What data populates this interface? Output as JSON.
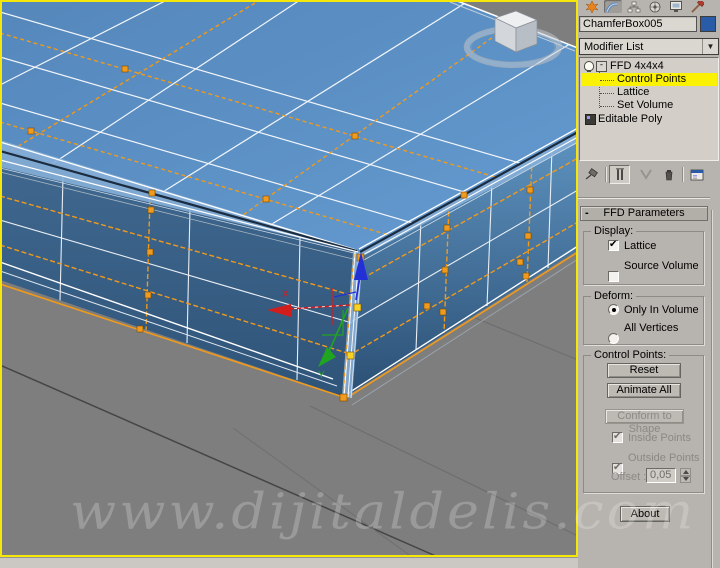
{
  "icons": {
    "check": "✔",
    "chevron_down": "▼",
    "minus": "-",
    "plus": "+"
  },
  "viewport": {
    "watermark": "www.dijitaldelis.com",
    "gizmo": {
      "x_label": "X",
      "y_label": "Y"
    }
  },
  "command_panel": {
    "tabs": [
      "create",
      "modify",
      "hierarchy",
      "motion",
      "display",
      "utilities"
    ],
    "object_name_field": {
      "value": "ChamferBox005"
    },
    "object_color": "#2A5BA7",
    "modifier_dropdown": {
      "value": "Modifier List"
    },
    "modifier_stack": {
      "items": [
        {
          "label": "FFD 4x4x4",
          "selected": false
        },
        {
          "label": "Control Points",
          "selected": true
        },
        {
          "label": "Lattice",
          "selected": false
        },
        {
          "label": "Set Volume",
          "selected": false
        },
        {
          "label": "Editable Poly",
          "selected": false
        }
      ]
    },
    "rollout": {
      "title": "FFD Parameters",
      "display_group": {
        "label": "Display:",
        "lattice": {
          "label": "Lattice",
          "checked": true
        },
        "source_volume": {
          "label": "Source Volume",
          "checked": false
        }
      },
      "deform_group": {
        "label": "Deform:",
        "only_in_volume": {
          "label": "Only In Volume",
          "selected": true
        },
        "all_vertices": {
          "label": "All Vertices",
          "selected": false
        }
      },
      "control_points_group": {
        "label": "Control Points:",
        "reset": "Reset",
        "animate_all": "Animate All",
        "conform": "Conform to Shape",
        "inside_points": {
          "label": "Inside Points",
          "checked": true,
          "enabled": false
        },
        "outside_points": {
          "label": "Outside Points",
          "checked": true,
          "enabled": false
        },
        "offset_label": "Offset :",
        "offset_value": "0,05"
      },
      "about": "About"
    }
  }
}
